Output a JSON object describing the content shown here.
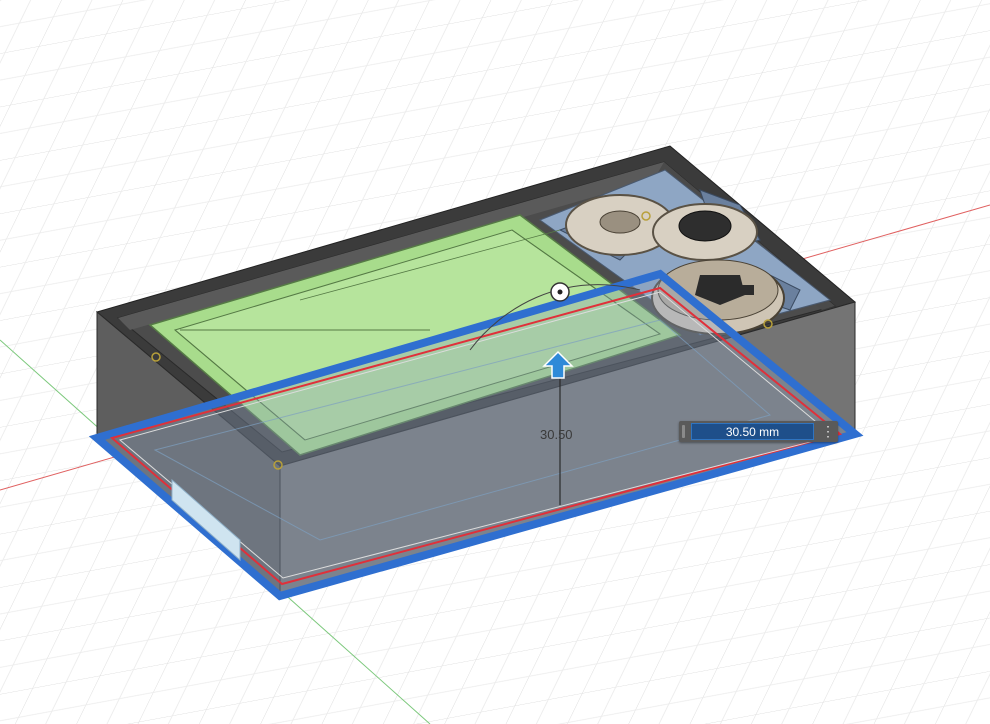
{
  "viewport": {
    "background": "#ffffff",
    "colors": {
      "grid": "#d9d9d9",
      "axis_x": "#e06060",
      "axis_y": "#6cc06c",
      "box_wall": "#6e6e6e",
      "box_top": "#3c3c3c",
      "lid_panel": "#a8dc8c",
      "parts": "#8fa8c8",
      "face_selection": "#2f6fd0",
      "outline_red": "#e0303a",
      "arrow": "#2f8ad8"
    },
    "icons": [
      "manipulator-arrow-icon",
      "pivot-ring-icon",
      "more-options-icon"
    ]
  },
  "dimension": {
    "label": "30.50",
    "input_value": "30.50 mm",
    "more_glyph": "⋮"
  }
}
